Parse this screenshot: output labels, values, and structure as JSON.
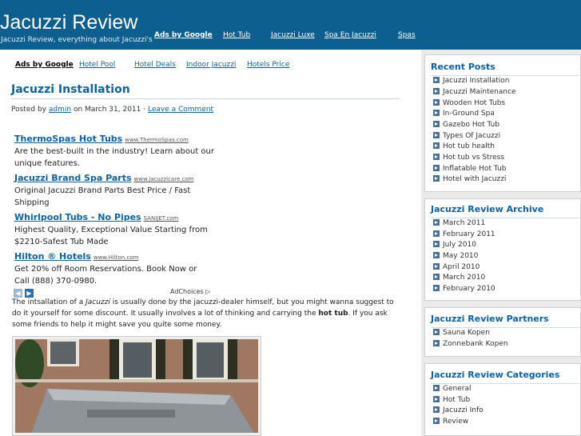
{
  "header": {
    "site_title": "Jacuzzi Review",
    "site_desc": "Jacuzzi Review, everything about Jacuzzi's",
    "nav": [
      "Ads by Google",
      "Hot Tub",
      "Jacuzzi Luxe",
      "Spa En Jacuzzi",
      "Spas"
    ]
  },
  "topnav": [
    "Ads by Google",
    "Hotel Pool",
    "Hotel Deals",
    "Indoor Jacuzzi",
    "Hotels Price"
  ],
  "post": {
    "title": "Jacuzzi Installation",
    "meta_prefix": "Posted by",
    "author": "admin",
    "meta_date": "on March 31, 2011 ·",
    "comment_link": "Leave a Comment",
    "body_1": "The intsallation of a",
    "body_em": "Jacuzzi",
    "body_2": "is usually done by the jacuzzi-dealer himself, but you might wanna suggest to do it yourself for some discount. It usually involves a lot of thinking and carrying the",
    "body_bold": "hot tub",
    "body_3": ". If you ask some friends to help it might save you quite some money."
  },
  "ads": [
    {
      "title": "ThermoSpas Hot Tubs",
      "url": "www.ThermoSpas.com",
      "desc": "Are the best-built in the industry! Learn about our unique features."
    },
    {
      "title": "Jacuzzi Brand Spa Parts",
      "url": "www.jacuzzicare.com",
      "desc": "Original Jacuzzi Brand Parts Best Price / Fast Shipping"
    },
    {
      "title": "Whirlpool Tubs - No Pipes",
      "url": "SANIJET.com",
      "desc": "Highest Quality, Exceptional Value Starting from $2210-Safest Tub Made"
    },
    {
      "title": "Hilton ® Hotels",
      "url": "www.Hilton.com",
      "desc": "Get 20% off Room Reservations. Book Now or Call (888) 370-0980."
    }
  ],
  "adchoices": "AdChoices ▷",
  "ad_prev": "◀",
  "ad_next": "▶",
  "sidebar": {
    "recent": {
      "title": "Recent Posts",
      "items": [
        "Jacuzzi Installation",
        "Jacuzzi Maintenance",
        "Wooden Hot Tubs",
        "In-Ground Spa",
        "Gazebo Hot Tub",
        "Types Of Jacuzzi",
        "Hot tub health",
        "Hot tub vs Stress",
        "Inflatable Hot Tub",
        "Hotel with Jacuzzi"
      ]
    },
    "archive": {
      "title": "Jacuzzi Review Archive",
      "items": [
        "March 2011",
        "February 2011",
        "July 2010",
        "May 2010",
        "April 2010",
        "March 2010",
        "February 2010"
      ]
    },
    "partners": {
      "title": "Jacuzzi Review Partners",
      "items": [
        "Sauna Kopen",
        "Zonnebank Kopen"
      ]
    },
    "categories": {
      "title": "Jacuzzi Review Categories",
      "items": [
        "General",
        "Hot Tub",
        "Jacuzzi Info",
        "Review"
      ]
    }
  },
  "colors": {
    "header_bg": "#0d5f8f",
    "link": "#0b63a8"
  }
}
